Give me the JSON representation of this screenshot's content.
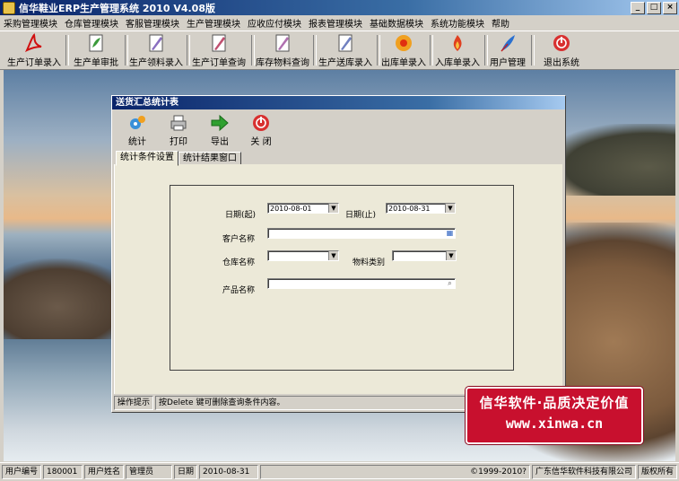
{
  "window": {
    "title": "信华鞋业ERP生产管理系统  2010 V4.08版",
    "buttons": {
      "minimize": "_",
      "maximize": "□",
      "close": "×"
    }
  },
  "menu": [
    "采购管理模块",
    "仓库管理模块",
    "客服管理模块",
    "生产管理模块",
    "应收应付模块",
    "报表管理模块",
    "基础数据模块",
    "系统功能模块",
    "帮助"
  ],
  "toolbar": [
    {
      "label": "生产订单录入",
      "icon": "acrobat-icon"
    },
    {
      "label": "生产单审批",
      "icon": "leaf-document-icon"
    },
    {
      "label": "生产领料录入",
      "icon": "pen-document-icon"
    },
    {
      "label": "生产订单查询",
      "icon": "pen-document-icon"
    },
    {
      "label": "库存物料查询",
      "icon": "pen-document-icon"
    },
    {
      "label": "生产送库录入",
      "icon": "pen-document-icon"
    },
    {
      "label": "出库单录入",
      "icon": "flower-icon"
    },
    {
      "label": "入库单录入",
      "icon": "flame-icon"
    },
    {
      "label": "用户管理",
      "icon": "feather-icon"
    },
    {
      "label": "退出系统",
      "icon": "power-icon"
    }
  ],
  "dialog": {
    "title": "送货汇总统计表",
    "toolbar": [
      {
        "label": "统计",
        "icon": "gears-icon"
      },
      {
        "label": "打印",
        "icon": "printer-icon"
      },
      {
        "label": "导出",
        "icon": "arrow-right-icon"
      },
      {
        "label": "关 闭",
        "icon": "power-icon"
      }
    ],
    "tabs": [
      "统计条件设置",
      "统计结果窗口"
    ],
    "form": {
      "date_start_label": "日期(起)",
      "date_start_value": "2010-08-01",
      "date_end_label": "日期(止)",
      "date_end_value": "2010-08-31",
      "customer_label": "客户名称",
      "customer_value": "",
      "warehouse_label": "仓库名称",
      "warehouse_value": "",
      "material_type_label": "物料类别",
      "material_type_value": "",
      "product_label": "产品名称",
      "product_value": ""
    },
    "hint_label": "操作提示",
    "hint_text": "按Delete 键可删除查询条件内容。"
  },
  "promo": {
    "line1": "信华软件·品质决定价值",
    "line2": "www.xinwa.cn"
  },
  "statusbar": {
    "user_id_label": "用户编号",
    "user_id": "180001",
    "user_name_label": "用户姓名",
    "user_name": "管理员",
    "date_label": "日期",
    "date": "2010-08-31",
    "copyright": "©1999-2010?",
    "company": "广东信华软件科技有限公司",
    "rights": "版权所有"
  },
  "colors": {
    "titlebar": "#0a246a",
    "face": "#d4d0c8",
    "promo": "#c8102e"
  }
}
